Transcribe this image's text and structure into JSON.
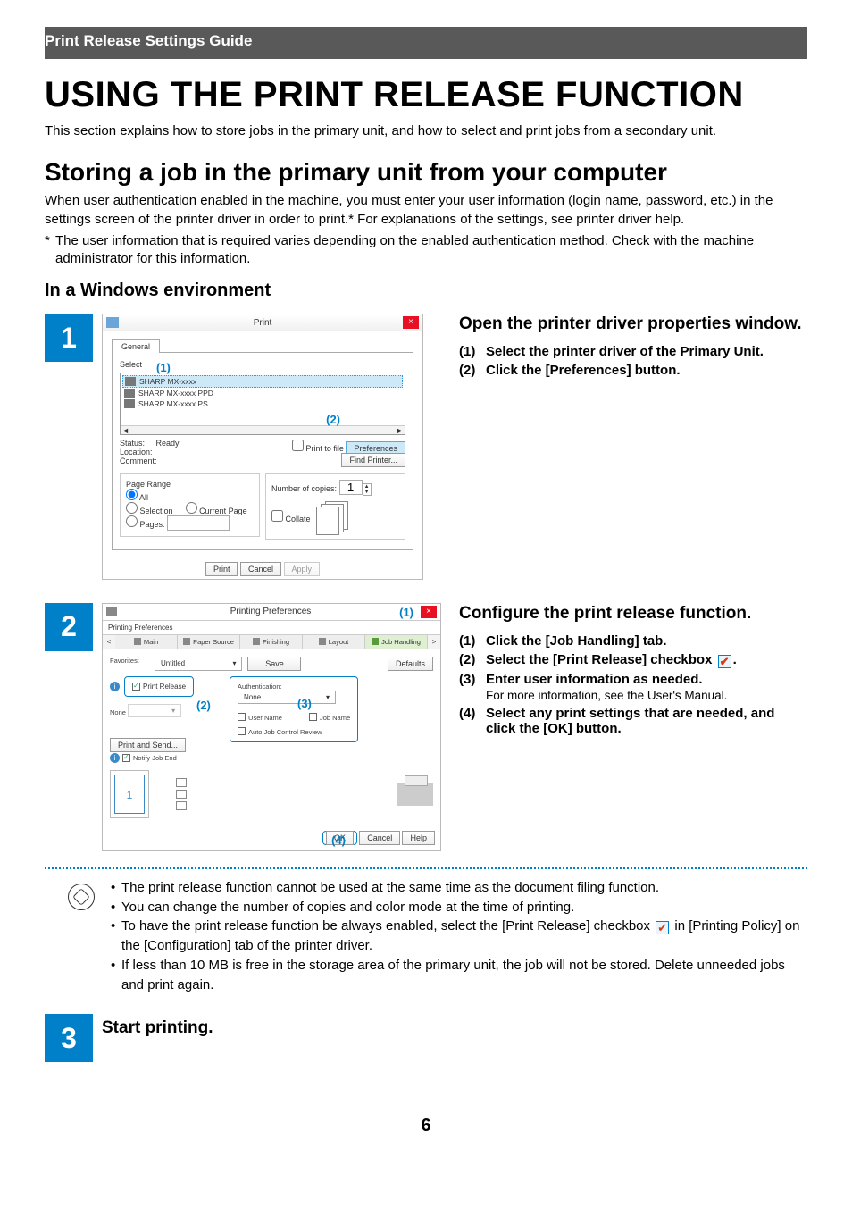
{
  "header": {
    "title": "Print Release Settings Guide"
  },
  "h1": "USING THE PRINT RELEASE FUNCTION",
  "intro": "This section explains how to store jobs in the primary unit, and how to select and print jobs from a secondary unit.",
  "h2": "Storing a job in the primary unit from your computer",
  "h2_p1": "When user authentication enabled in the machine, you must enter your user information (login name, password, etc.) in the settings screen of the printer driver in order to print.* For explanations of the settings, see printer driver help.",
  "h2_p2_prefix": "*",
  "h2_p2": "The user information that is required varies depending on the enabled authentication method. Check with the machine administrator for this information.",
  "h3": "In a Windows environment",
  "steps": {
    "s1": {
      "num": "1",
      "title": "Open the printer driver properties window.",
      "items": [
        {
          "n": "(1)",
          "t": "Select the printer driver of the Primary Unit."
        },
        {
          "n": "(2)",
          "t": "Click the [Preferences] button."
        }
      ]
    },
    "s2": {
      "num": "2",
      "title": "Configure the print release function.",
      "items": [
        {
          "n": "(1)",
          "t": "Click the [Job Handling] tab."
        },
        {
          "n": "(2)",
          "t": "Select the [Print Release] checkbox "
        },
        {
          "n": "(3)",
          "t": "Enter user information as needed.",
          "sub": "For more information, see the User's Manual."
        },
        {
          "n": "(4)",
          "t": "Select any print settings that are needed, and click the [OK] button."
        }
      ]
    },
    "s3": {
      "num": "3",
      "title": "Start printing."
    }
  },
  "notes": [
    "The print release function cannot be used at the same time as the document filing function.",
    "You can change the number of copies and color mode at the time of printing.",
    "To have the print release function be always enabled, select the [Print Release] checkbox ",
    " in [Printing Policy] on the [Configuration] tab of the printer driver.",
    "If less than 10 MB is free in the storage area of the primary unit, the job will not be stored. Delete unneeded jobs and print again."
  ],
  "page_number": "6",
  "dialog1": {
    "title": "Print",
    "tab": "General",
    "select_label": "Select",
    "printers": [
      "SHARP MX-xxxx",
      "SHARP MX-xxxx PPD",
      "SHARP MX-xxxx PS"
    ],
    "status_label": "Status:",
    "status_value": "Ready",
    "location_label": "Location:",
    "comment_label": "Comment:",
    "print_to_file": "Print to file",
    "preferences": "Preferences",
    "find_printer": "Find Printer...",
    "page_range": "Page Range",
    "all": "All",
    "selection": "Selection",
    "current_page": "Current Page",
    "pages": "Pages:",
    "copies_label": "Number of copies:",
    "copies_value": "1",
    "collate": "Collate",
    "btn_print": "Print",
    "btn_cancel": "Cancel",
    "btn_apply": "Apply",
    "callout1": "(1)",
    "callout2": "(2)"
  },
  "dialog2": {
    "title": "Printing Preferences",
    "top_label": "Printing Preferences",
    "nav_left": "<",
    "nav_right": ">",
    "tabs": [
      "Main",
      "Paper Source",
      "Finishing",
      "Layout",
      "Job Handling"
    ],
    "favorites": "Favorites:",
    "fav_value": "Untitled",
    "save": "Save",
    "defaults": "Defaults",
    "print_release": "Print Release",
    "none": "None",
    "auth": "Authentication:",
    "auth_none": "None",
    "user_name": "User Name",
    "job_name": "Job Name",
    "auto_review": "Auto Job Control Review",
    "print_and_send": "Print and Send...",
    "notify_end": "Notify Job End",
    "one": "1",
    "ok": "OK",
    "cancel": "Cancel",
    "help": "Help",
    "callout1": "(1)",
    "callout2": "(2)",
    "callout3": "(3)",
    "callout4": "(4)"
  }
}
